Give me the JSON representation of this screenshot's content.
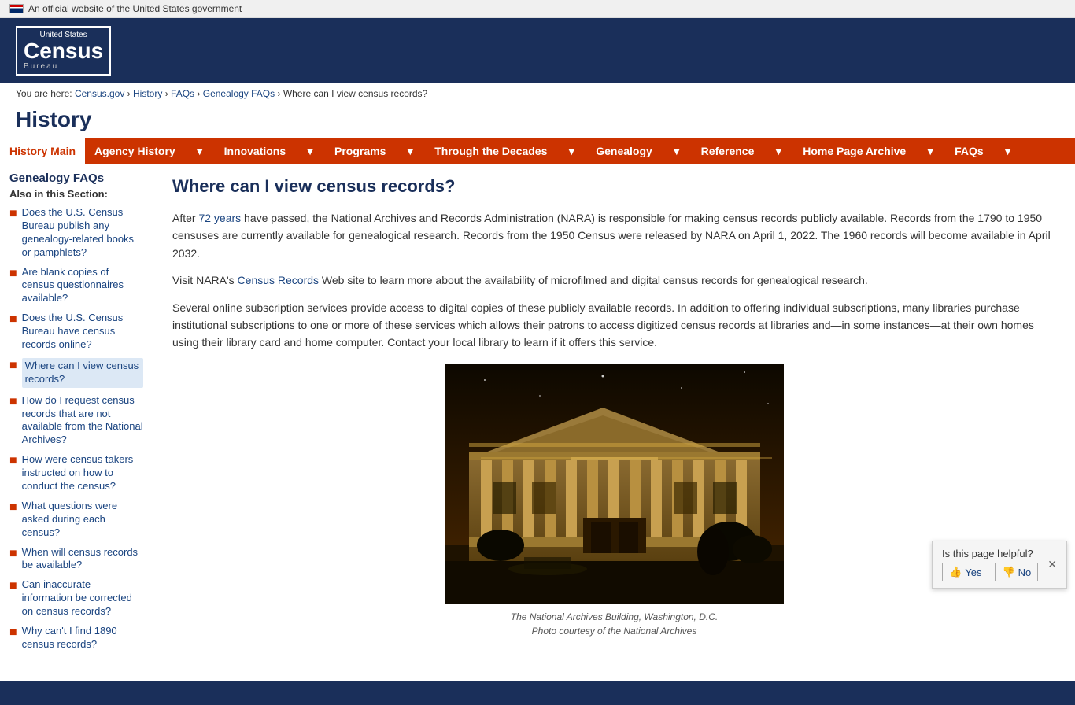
{
  "gov_banner": {
    "flag": "US flag",
    "text": "An official website of the United States government"
  },
  "header": {
    "logo_top": "United States",
    "logo_main": "Census",
    "logo_bottom": "Bureau"
  },
  "breadcrumb": {
    "items": [
      {
        "label": "You are here:",
        "link": false
      },
      {
        "label": "Census.gov",
        "link": true,
        "href": "#"
      },
      {
        "label": "History",
        "link": true,
        "href": "#"
      },
      {
        "label": "FAQs",
        "link": true,
        "href": "#"
      },
      {
        "label": "Genealogy FAQs",
        "link": true,
        "href": "#"
      },
      {
        "label": "Where can I view census records?",
        "link": false
      }
    ]
  },
  "page_title": "History",
  "nav": {
    "items": [
      {
        "label": "History Main",
        "active": true,
        "dropdown": false
      },
      {
        "label": "Agency History",
        "active": false,
        "dropdown": true
      },
      {
        "label": "Innovations",
        "active": false,
        "dropdown": true
      },
      {
        "label": "Programs",
        "active": false,
        "dropdown": true
      },
      {
        "label": "Through the Decades",
        "active": false,
        "dropdown": true
      },
      {
        "label": "Genealogy",
        "active": false,
        "dropdown": true
      },
      {
        "label": "Reference",
        "active": false,
        "dropdown": true
      },
      {
        "label": "Home Page Archive",
        "active": false,
        "dropdown": true
      },
      {
        "label": "FAQs",
        "active": false,
        "dropdown": true
      }
    ]
  },
  "sidebar": {
    "title": "Genealogy FAQs",
    "section_title": "Also in this Section:",
    "links": [
      {
        "label": "Does the U.S. Census Bureau publish any genealogy-related books or pamphlets?",
        "active": false
      },
      {
        "label": "Are blank copies of census questionnaires available?",
        "active": false
      },
      {
        "label": "Does the U.S. Census Bureau have census records online?",
        "active": false
      },
      {
        "label": "Where can I view census records?",
        "active": true
      },
      {
        "label": "How do I request census records that are not available from the National Archives?",
        "active": false
      },
      {
        "label": "How were census takers instructed on how to conduct the census?",
        "active": false
      },
      {
        "label": "What questions were asked during each census?",
        "active": false
      },
      {
        "label": "When will census records be available?",
        "active": false
      },
      {
        "label": "Can inaccurate information be corrected on census records?",
        "active": false
      },
      {
        "label": "Why can't I find 1890 census records?",
        "active": false
      }
    ]
  },
  "main": {
    "heading": "Where can I view census records?",
    "para1_before": "After ",
    "para1_link": "72 years",
    "para1_after": " have passed, the National Archives and Records Administration (NARA) is responsible for making census records publicly available. Records from the 1790 to 1950 censuses are currently available for genealogical research. Records from the 1950 Census were released by NARA on April 1, 2022. The 1960 records will become available in April 2032.",
    "para2_before": "Visit NARA's ",
    "para2_link": "Census Records",
    "para2_after": " Web site to learn more about the availability of microfilmed and digital census records for genealogical research.",
    "para3": "Several online subscription services provide access to digital copies of these publicly available records. In addition to offering individual subscriptions, many libraries purchase institutional subscriptions to one or more of these services which allows their patrons to access digitized census records at libraries and—in some instances—at their own homes using their library card and home computer. Contact your local library to learn if it offers this service.",
    "image_caption_1": "The National Archives Building, Washington, D.C.",
    "image_caption_2": "Photo courtesy of the National Archives"
  },
  "helpful_widget": {
    "question": "Is this page helpful?",
    "yes_label": "Yes",
    "no_label": "No"
  }
}
